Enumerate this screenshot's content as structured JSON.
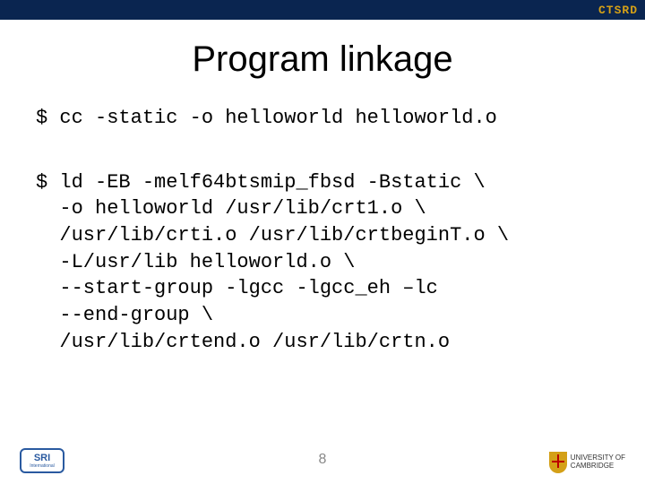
{
  "topbar": {
    "brand": "CTSRD"
  },
  "title": "Program linkage",
  "code": {
    "line1": "$ cc -static -o helloworld helloworld.o",
    "line2": "$ ld -EB -melf64btsmip_fbsd -Bstatic \\\n  -o helloworld /usr/lib/crt1.o \\\n  /usr/lib/crti.o /usr/lib/crtbeginT.o \\\n  -L/usr/lib helloworld.o \\\n  --start-group -lgcc -lgcc_eh –lc\n  --end-group \\\n  /usr/lib/crtend.o /usr/lib/crtn.o"
  },
  "page_number": "8",
  "logos": {
    "sri_main": "SRI",
    "sri_sub": "International",
    "cambridge_line1": "UNIVERSITY OF",
    "cambridge_line2": "CAMBRIDGE"
  }
}
